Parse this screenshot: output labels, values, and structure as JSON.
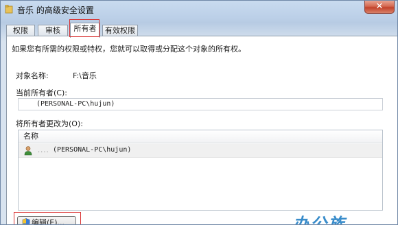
{
  "window": {
    "title": "音乐 的高级安全设置",
    "close_glyph": "✕"
  },
  "tabs": [
    {
      "label": "权限",
      "active": false
    },
    {
      "label": "审核",
      "active": false
    },
    {
      "label": "所有者",
      "active": true
    },
    {
      "label": "有效权限",
      "active": false
    }
  ],
  "panel": {
    "info_text": "如果您有所需的权限或特权，您就可以取得或分配这个对象的所有权。",
    "object_name_label": "对象名称:",
    "object_name_value": "F:\\音乐",
    "current_owner_label": "当前所有者(C):",
    "current_owner_value": "(PERSONAL-PC\\hujun)",
    "change_owner_label": "将所有者更改为(O):",
    "list_header": "名称",
    "list_items": [
      {
        "dots": "....",
        "name": "(PERSONAL-PC\\hujun)",
        "icon": "user-icon"
      }
    ],
    "edit_button_label": "编辑(E)..."
  },
  "watermark": "办公族",
  "colors": {
    "highlight": "#d93030",
    "watermark": "#2f86c8"
  }
}
